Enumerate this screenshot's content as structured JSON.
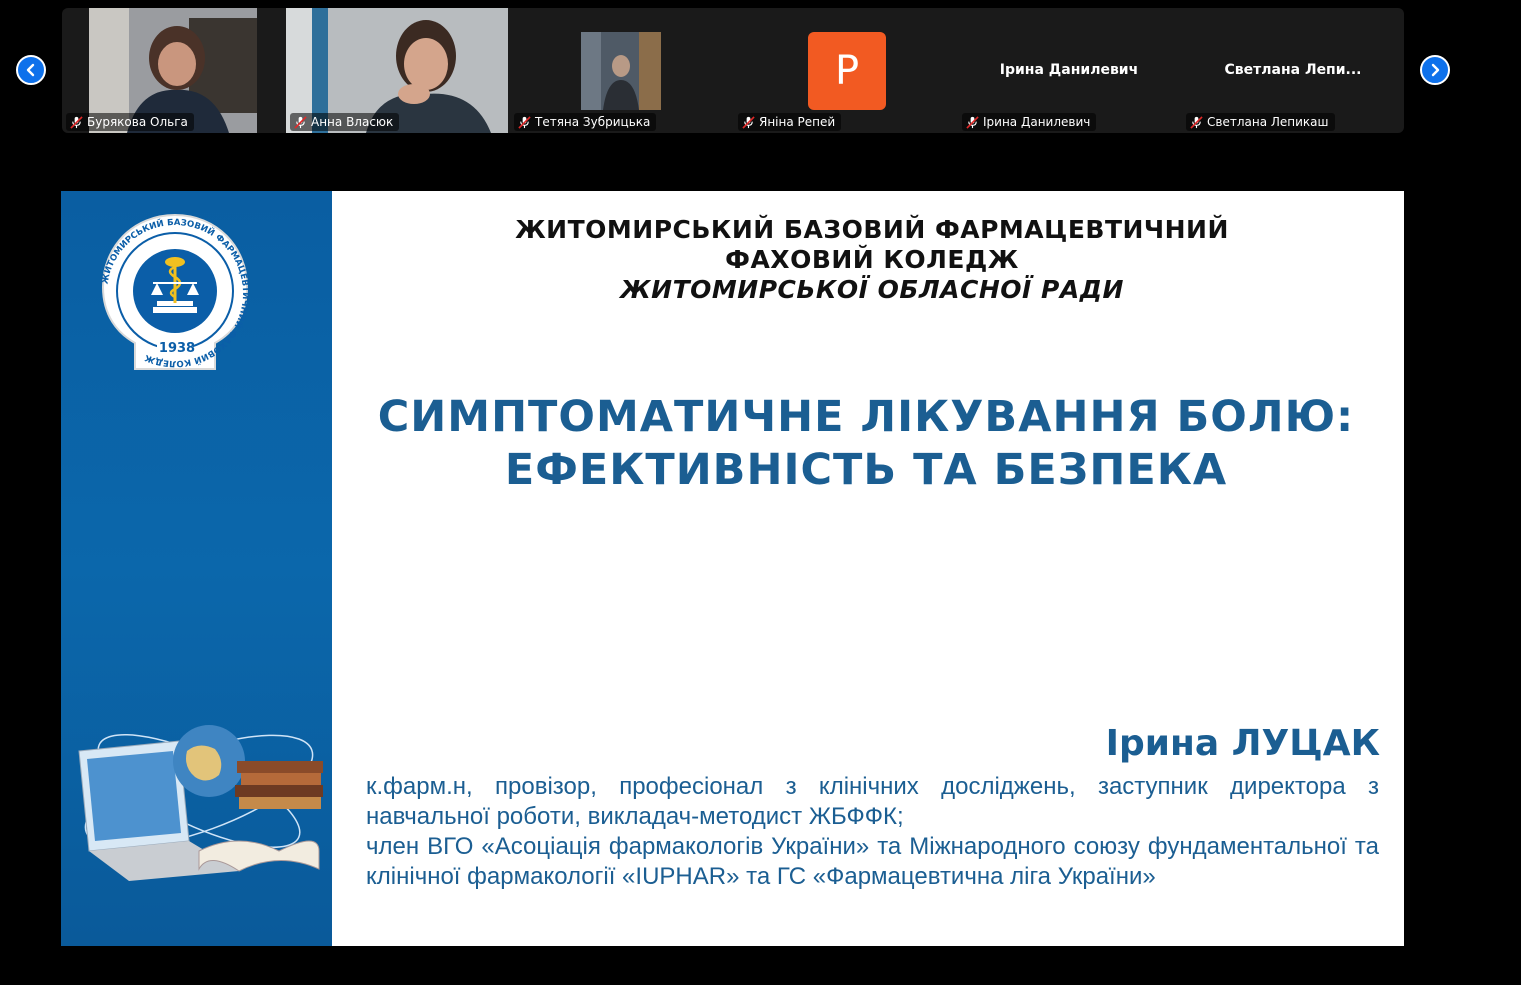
{
  "participants": [
    {
      "name": "Бурякова Ольга",
      "type": "video"
    },
    {
      "name": "Анна Власюк",
      "type": "video"
    },
    {
      "name": "Тетяна Зубрицька",
      "type": "video-small"
    },
    {
      "name": "Яніна Репей",
      "type": "avatar",
      "avatar_letter": "P"
    },
    {
      "name": "Ірина Данилевич",
      "type": "name",
      "display_name": "Ірина Данилевич"
    },
    {
      "name": "Светлана Лепикаш",
      "type": "name",
      "display_name": "Светлана  Лепи..."
    }
  ],
  "slide": {
    "college_line1": "ЖИТОМИРСЬКИЙ БАЗОВИЙ ФАРМАЦЕВТИЧНИЙ",
    "college_line2": "ФАХОВИЙ КОЛЕДЖ",
    "college_line3": "ЖИТОМИРСЬКОЇ ОБЛАСНОЇ РАДИ",
    "logo_ring_text": "ЖИТОМИРСЬКИЙ БАЗОВИЙ ФАРМАЦЕВТИЧНИЙ ФАХОВИЙ КОЛЕДЖ",
    "logo_year": "1938",
    "title_line1": "СИМПТОМАТИЧНЕ ЛІКУВАННЯ БОЛЮ:",
    "title_line2": "ЕФЕКТИВНІСТЬ ТА БЕЗПЕКА",
    "author": "Ірина ЛУЦАК",
    "desc_line1": "к.фарм.н, провізор, професіонал з клінічних досліджень, заступник директора з навчальної роботи, викладач-методист ЖБФФК;",
    "desc_line2": "член ВГО «Асоціація фармакологів України» та Міжнародного союзу фундаментальної та клінічної фармакології «IUPHAR» та ГС «Фармацевтична ліга України»"
  },
  "colors": {
    "accent": "#0e71eb",
    "slide_blue": "#0b67ab",
    "title_blue": "#1b5e92",
    "avatar_orange": "#f25a22"
  }
}
